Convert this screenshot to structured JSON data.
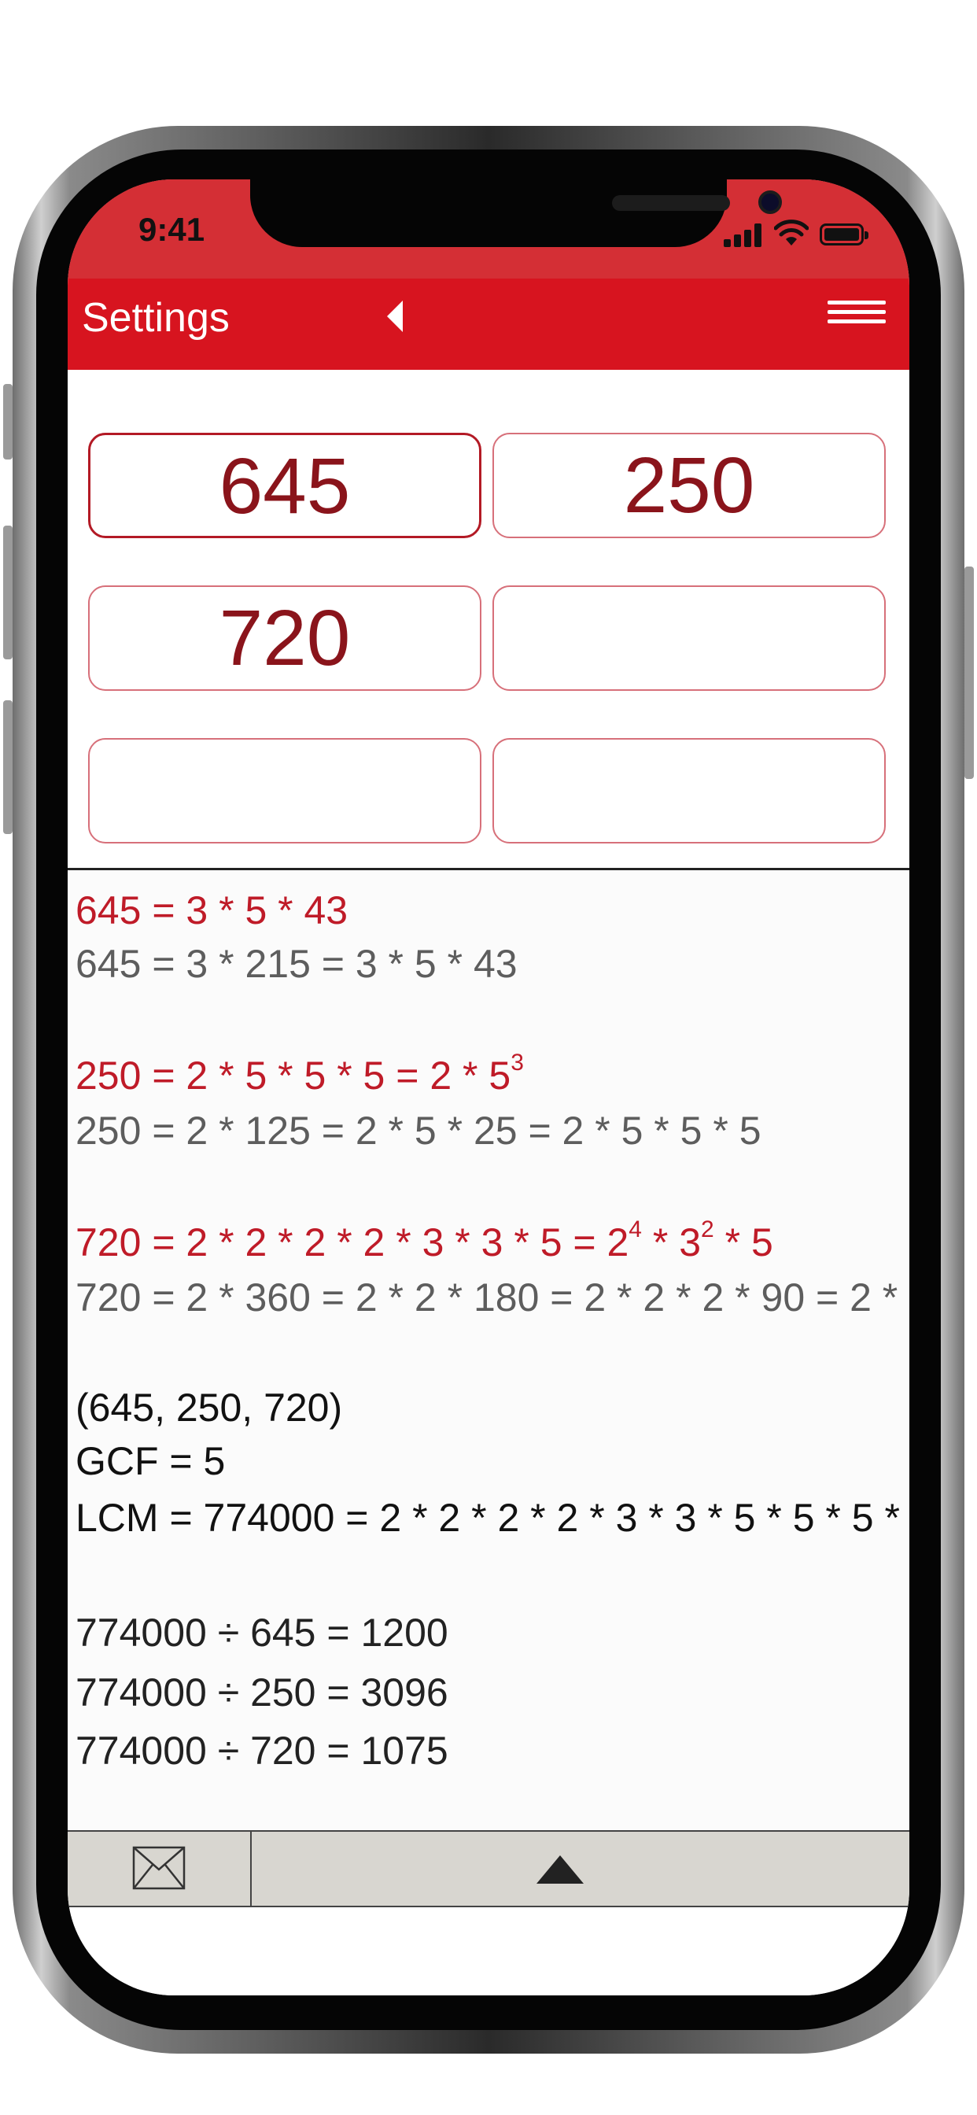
{
  "status_bar": {
    "time": "9:41"
  },
  "header": {
    "title": "Settings"
  },
  "inputs": {
    "values": [
      "645",
      "250",
      "720",
      "",
      "",
      ""
    ]
  },
  "results": {
    "f1": {
      "main": "645 = 3 * 5 * 43",
      "steps": "645 = 3 * 215 = 3 * 5 * 43"
    },
    "f2": {
      "main_text": "250 = 2 * 5 * 5 * 5 = 2 * 5",
      "main_exp": "3",
      "steps": "250 = 2 * 125 = 2 * 5 * 25 = 2 * 5 * 5 * 5"
    },
    "f3": {
      "main_a": "720 = 2 * 2 * 2 * 2 * 3 * 3 * 5 = 2",
      "exp_a": "4",
      "main_b": " * 3",
      "exp_b": "2",
      "main_c": " * 5",
      "steps": "720 = 2 * 360 = 2 * 2 * 180 = 2 * 2 * 2 * 90 = 2 *"
    },
    "set": "(645, 250, 720)",
    "gcf": "GCF = 5",
    "lcm": "LCM = 774000 = 2 * 2 * 2 * 2 * 3 * 3 * 5 * 5 * 5 *",
    "div1": "774000 ÷ 645 = 1200",
    "div2": "774000 ÷ 250 = 3096",
    "div3": "774000 ÷ 720 = 1075"
  },
  "colors": {
    "header_red": "#d7141f",
    "result_red": "#bf1b28",
    "input_text": "#8a141b",
    "toolbar": "#d8d6d0"
  },
  "icons": {
    "back": "back-triangle-icon",
    "menu": "hamburger-menu-icon",
    "mail": "envelope-icon",
    "up": "up-arrow-icon"
  }
}
